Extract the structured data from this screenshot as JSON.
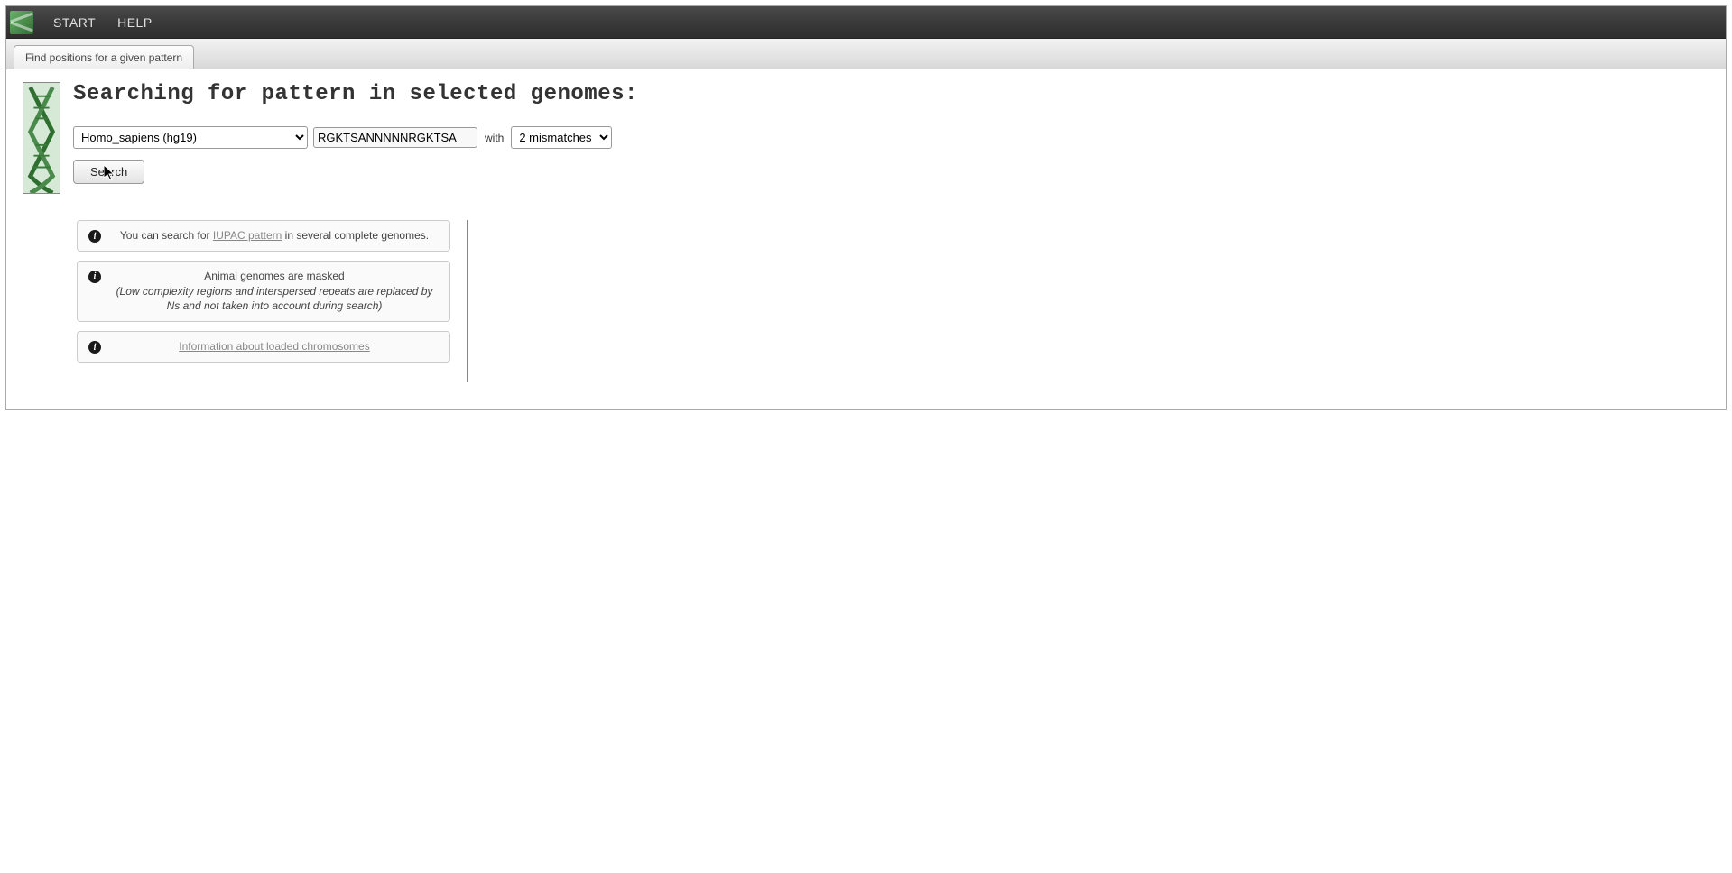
{
  "nav": {
    "start": "START",
    "help": "HELP"
  },
  "tab": {
    "label": "Find positions for a given pattern"
  },
  "page": {
    "title": "Searching for pattern in selected genomes:"
  },
  "form": {
    "genome_selected": "Homo_sapiens (hg19)",
    "pattern_value": "RGKTSANNNNNRGKTSA",
    "with_label": "with",
    "mismatch_selected": "2 mismatches",
    "search_label": "Search"
  },
  "info": {
    "box1_prefix": "You can search for ",
    "box1_link": "IUPAC pattern",
    "box1_suffix": " in several complete genomes.",
    "box2_line1": "Animal genomes are masked",
    "box2_line2": "(Low complexity regions and interspersed repeats are replaced by Ns and not taken into account during search)",
    "box3_link": "Information about loaded chromosomes"
  }
}
